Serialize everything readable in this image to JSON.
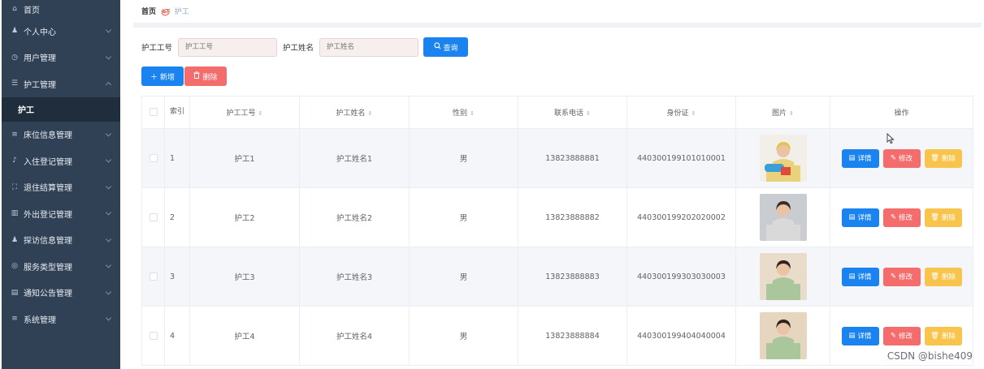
{
  "sidebar": {
    "items": [
      {
        "label": "首页",
        "icon": "home-icon",
        "glyph": "⌂",
        "expandable": false
      },
      {
        "label": "个人中心",
        "icon": "user-icon",
        "glyph": "♟",
        "expandable": true
      },
      {
        "label": "用户管理",
        "icon": "clock-icon",
        "glyph": "◷",
        "expandable": true
      },
      {
        "label": "护工管理",
        "icon": "sliders-icon",
        "glyph": "☰",
        "expandable": true,
        "open": true
      },
      {
        "label": "床位信息管理",
        "icon": "list-icon",
        "glyph": "≡",
        "expandable": true
      },
      {
        "label": "入住登记管理",
        "icon": "mic-icon",
        "glyph": "♪",
        "expandable": true
      },
      {
        "label": "退住结算管理",
        "icon": "fullscreen-icon",
        "glyph": "⛶",
        "expandable": true
      },
      {
        "label": "外出登记管理",
        "icon": "chart-icon",
        "glyph": "▥",
        "expandable": true
      },
      {
        "label": "探访信息管理",
        "icon": "user-icon",
        "glyph": "♟",
        "expandable": true
      },
      {
        "label": "服务类型管理",
        "icon": "compass-icon",
        "glyph": "◎",
        "expandable": true
      },
      {
        "label": "通知公告管理",
        "icon": "wallet-icon",
        "glyph": "▤",
        "expandable": true
      },
      {
        "label": "系统管理",
        "icon": "menu-icon",
        "glyph": "≡",
        "expandable": true
      }
    ],
    "active_sub": "护工"
  },
  "breadcrumb": {
    "home": "首页",
    "separator": "ஞ",
    "current": "护工"
  },
  "search": {
    "id_label": "护工工号",
    "id_placeholder": "护工工号",
    "name_label": "护工姓名",
    "name_placeholder": "护工姓名",
    "button": "查询"
  },
  "actions": {
    "add": "新增",
    "delete": "删除"
  },
  "table": {
    "headers": {
      "index": "索引",
      "id": "护工工号",
      "name": "护工姓名",
      "gender": "性别",
      "phone": "联系电话",
      "idcard": "身份证",
      "photo": "图片",
      "ops": "操作"
    },
    "rows": [
      {
        "index": "1",
        "id": "护工1",
        "name": "护工姓名1",
        "gender": "男",
        "phone": "13823888881",
        "idcard": "440300199101010001"
      },
      {
        "index": "2",
        "id": "护工2",
        "name": "护工姓名2",
        "gender": "男",
        "phone": "13823888882",
        "idcard": "440300199202020002"
      },
      {
        "index": "3",
        "id": "护工3",
        "name": "护工姓名3",
        "gender": "男",
        "phone": "13823888883",
        "idcard": "440300199303030003"
      },
      {
        "index": "4",
        "id": "护工4",
        "name": "护工姓名4",
        "gender": "男",
        "phone": "13823888884",
        "idcard": "440300199404040004"
      }
    ],
    "op_labels": {
      "detail": "详情",
      "edit": "修改",
      "delete": "删除"
    }
  },
  "colors": {
    "sidebar_bg": "#304156",
    "primary": "#1a83f0",
    "danger": "#f56c6c",
    "warning": "#f8c44c"
  },
  "watermark": "CSDN @bishe409"
}
